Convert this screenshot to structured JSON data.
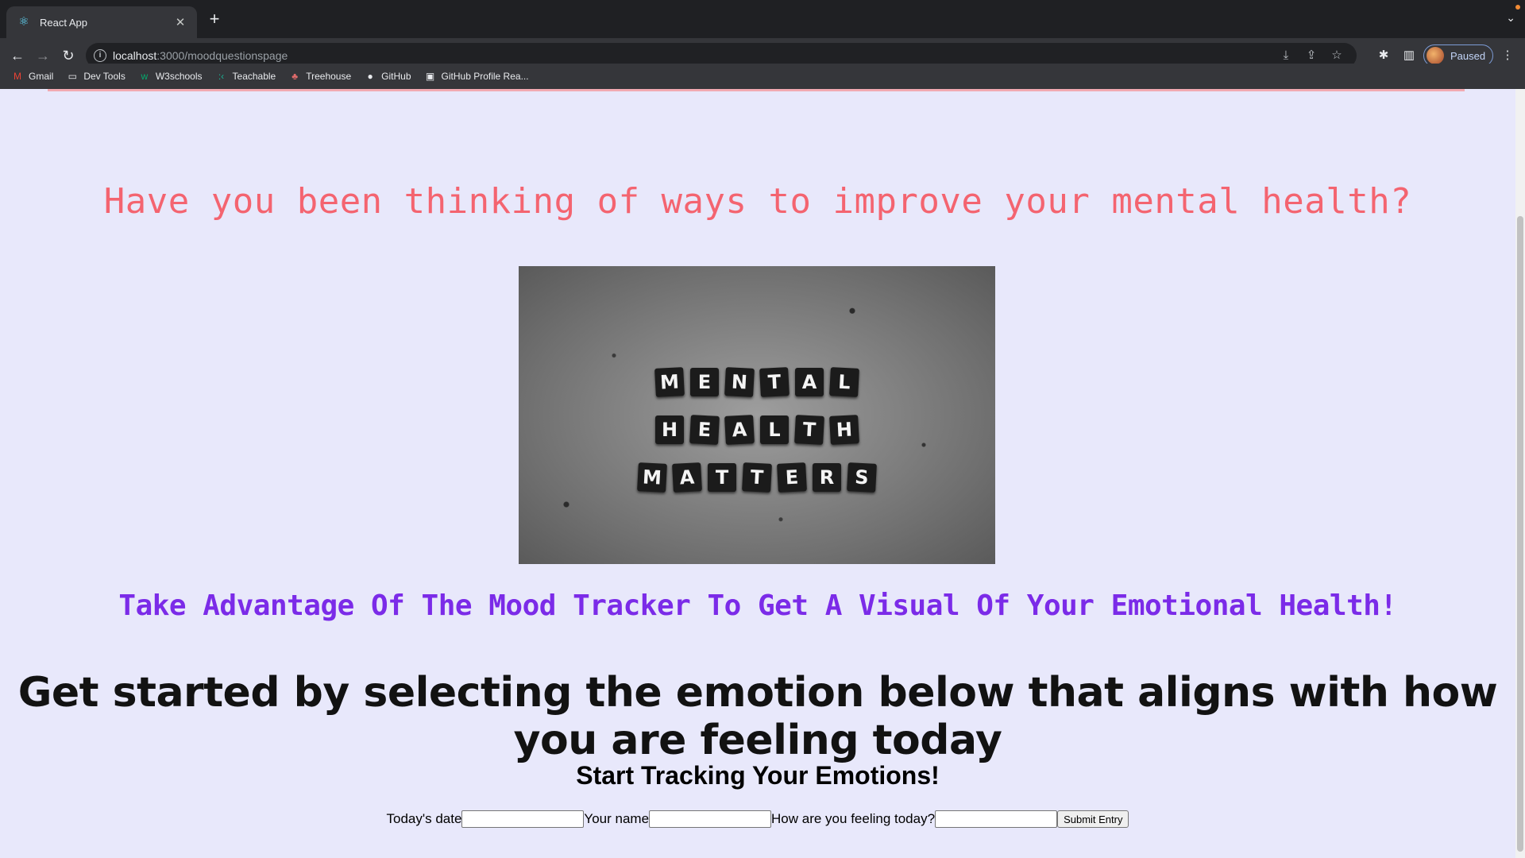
{
  "browser": {
    "tab_title": "React App",
    "tab_favicon": "react-icon",
    "url_host": "localhost",
    "url_path": ":3000/moodquestionspage",
    "profile_label": "Paused",
    "bookmarks": [
      {
        "label": "Gmail",
        "icon": "gmail-icon",
        "color": "#ea4335"
      },
      {
        "label": "Dev Tools",
        "icon": "folder-icon",
        "color": "#e8eaed"
      },
      {
        "label": "W3schools",
        "icon": "w3schools-icon",
        "color": "#04aa6d"
      },
      {
        "label": "Teachable",
        "icon": "teachable-icon",
        "color": "#1ab394"
      },
      {
        "label": "Treehouse",
        "icon": "treehouse-icon",
        "color": "#e06b6b"
      },
      {
        "label": "GitHub",
        "icon": "github-icon",
        "color": "#e8eaed"
      },
      {
        "label": "GitHub Profile Rea...",
        "icon": "readme-icon",
        "color": "#e8eaed"
      }
    ]
  },
  "page": {
    "headline1": "Have you been thinking of ways to improve your mental health?",
    "image_tiles": [
      [
        "M",
        "E",
        "N",
        "T",
        "A",
        "L"
      ],
      [
        "H",
        "E",
        "A",
        "L",
        "T",
        "H"
      ],
      [
        "M",
        "A",
        "T",
        "T",
        "E",
        "R",
        "S"
      ]
    ],
    "headline2": "Take Advantage Of The Mood Tracker To Get A Visual Of Your Emotional Health!",
    "headline3": "Get started by selecting the emotion below that aligns with how you are feeling today",
    "form": {
      "title": "Start Tracking Your Emotions!",
      "date_label": "Today's date",
      "name_label": "Your name",
      "feeling_label": "How are you feeling today?",
      "submit_label": "Submit Entry"
    }
  },
  "colors": {
    "page_bg": "#e8e8fb",
    "headline1": "#f46470",
    "headline2": "#7b2be8",
    "headline3": "#121212"
  }
}
